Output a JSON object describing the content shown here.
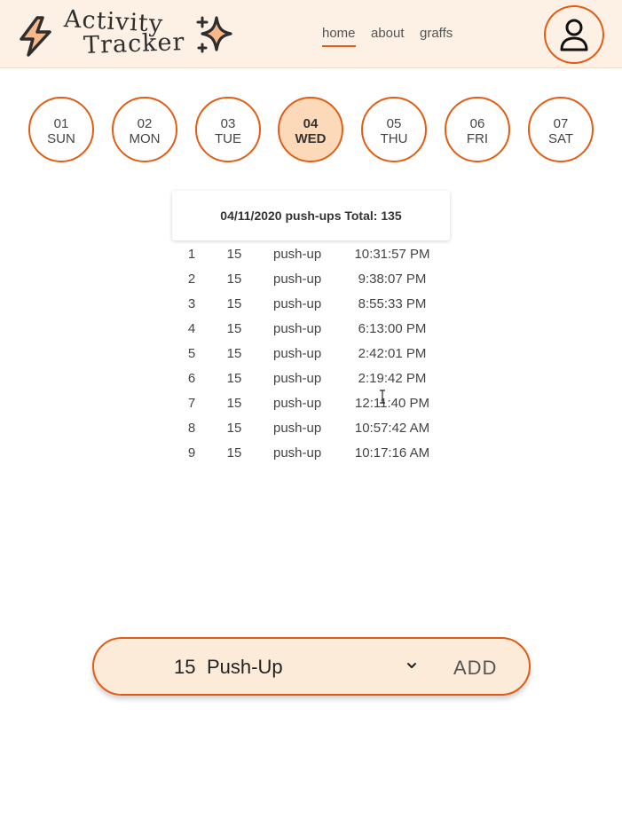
{
  "header": {
    "logo": {
      "line1": "Activity",
      "line2": "Tracker",
      "icons": [
        "lightning-bolt-icon",
        "sparkle-icon"
      ]
    },
    "nav": [
      {
        "label": "home",
        "active": true
      },
      {
        "label": "about",
        "active": false
      },
      {
        "label": "graffs",
        "active": false
      }
    ],
    "profile_icon": "user-icon"
  },
  "days": [
    {
      "num": "01",
      "dow": "SUN",
      "selected": false
    },
    {
      "num": "02",
      "dow": "MON",
      "selected": false
    },
    {
      "num": "03",
      "dow": "TUE",
      "selected": false
    },
    {
      "num": "04",
      "dow": "WED",
      "selected": true
    },
    {
      "num": "05",
      "dow": "THU",
      "selected": false
    },
    {
      "num": "06",
      "dow": "FRI",
      "selected": false
    },
    {
      "num": "07",
      "dow": "SAT",
      "selected": false
    }
  ],
  "summary": {
    "title": "04/11/2020 push-ups Total: 135"
  },
  "entries": [
    {
      "idx": "1",
      "count": "15",
      "activity": "push-up",
      "time": "10:31:57 PM"
    },
    {
      "idx": "2",
      "count": "15",
      "activity": "push-up",
      "time": "9:38:07 PM"
    },
    {
      "idx": "3",
      "count": "15",
      "activity": "push-up",
      "time": "8:55:33 PM"
    },
    {
      "idx": "4",
      "count": "15",
      "activity": "push-up",
      "time": "6:13:00 PM"
    },
    {
      "idx": "5",
      "count": "15",
      "activity": "push-up",
      "time": "2:42:01 PM"
    },
    {
      "idx": "6",
      "count": "15",
      "activity": "push-up",
      "time": "2:19:42 PM"
    },
    {
      "idx": "7",
      "count": "15",
      "activity": "push-up",
      "time": "12:11:40 PM"
    },
    {
      "idx": "8",
      "count": "15",
      "activity": "push-up",
      "time": "10:57:42 AM"
    },
    {
      "idx": "9",
      "count": "15",
      "activity": "push-up",
      "time": "10:17:16 AM"
    }
  ],
  "add_bar": {
    "selected_count": "15",
    "selected_activity": "Push-Up",
    "add_label": "ADD"
  },
  "colors": {
    "accent": "#e25d14",
    "header_bg": "#fdf0e4",
    "selected_day_bg": "#fcd9b8",
    "add_bar_bg": "#fdebd9"
  }
}
